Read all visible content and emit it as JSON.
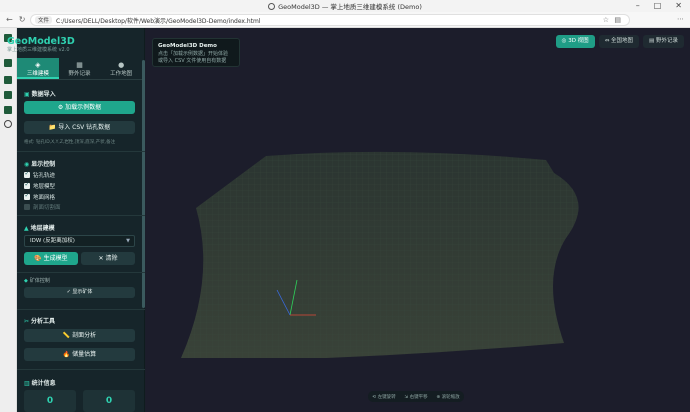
{
  "browser": {
    "title": "GeoModel3D — 掌上地质三维建模系统 (Demo)",
    "url_chip": "文件",
    "url": "C:/Users/DELL/Desktop/软件/Web演示/GeoModel3D-Demo/index.html"
  },
  "sidebar": {
    "brand": "GeoModel3D",
    "brand_sub": "掌上地质三维建模系统 v2.0",
    "tabs": [
      {
        "label": "三维建模",
        "icon": "layers-icon"
      },
      {
        "label": "野外记录",
        "icon": "notebook-icon"
      },
      {
        "label": "工作地图",
        "icon": "globe-icon"
      }
    ],
    "data_import": {
      "title": "数据导入",
      "load_sample": "⚙ 加载示例数据",
      "import_csv": "📁 导入 CSV 钻孔数据",
      "hint": "格式: 钻孔ID,X,Y,Z,岩性,顶深,底深,产状,备注"
    },
    "display": {
      "title": "显示控制",
      "items": [
        {
          "label": "钻孔轨迹",
          "checked": true
        },
        {
          "label": "地层模型",
          "checked": true
        },
        {
          "label": "地面网格",
          "checked": true
        },
        {
          "label": "剖面切割面",
          "checked": false
        }
      ]
    },
    "modeling": {
      "title": "地层建模",
      "method": "IDW (反距离加权)",
      "generate": "🎨 生成模型",
      "clear": "✕ 清除"
    },
    "mine": {
      "title": "矿体控制",
      "show_ore": "✓ 显示矿体"
    },
    "analysis": {
      "title": "分析工具",
      "section": "📏 剖面分析",
      "reserve": "🔥 储量估算"
    },
    "stats": {
      "title": "统计信息",
      "values": [
        "0",
        "0"
      ]
    }
  },
  "viewport": {
    "info_title": "GeoModel3D Demo",
    "info_body": "点击「加载示例数据」开始体验\n或导入 CSV 文件使用自有数据",
    "top_buttons": [
      "◎ 3D 视图",
      "⇔ 全国地图",
      "▤ 野外记录"
    ],
    "bottom_hints": [
      "⟲ 左键旋转",
      "⇲ 右键平移",
      "⊕ 滚轮缩放"
    ]
  }
}
